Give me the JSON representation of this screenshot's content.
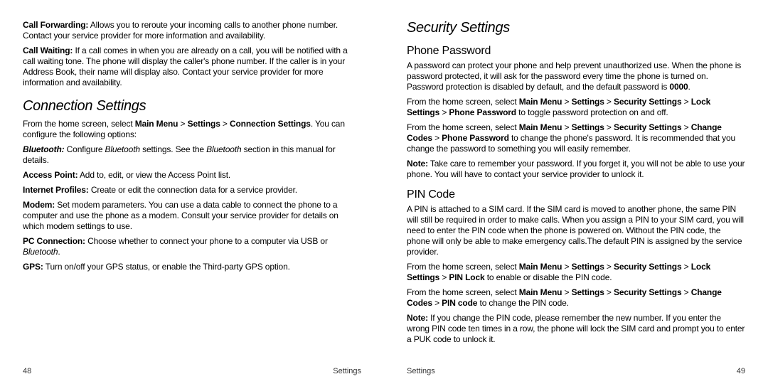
{
  "left": {
    "p1_label": "Call Forwarding:",
    "p1_text": " Allows you to reroute your incoming calls to another phone number. Contact your service provider for more information and availability.",
    "p2_label": "Call Waiting:",
    "p2_text": " If a call comes in when you are already on a call, you will be notified with a call waiting tone. The phone will display the caller's phone number. If the caller is in your Address Book, their name will display also. Contact your service provider for more information and availability.",
    "h2": "Connection Settings",
    "nav_pre": "From the home screen, select ",
    "nav_mm": "Main Menu",
    "gt": " > ",
    "nav_set": "Settings",
    "nav_cs": "Connection Settings",
    "nav_post": ". You can configure the following options:",
    "bt_label": "Bluetooth:",
    "bt_t1": " Configure ",
    "bt_w": "Bluetooth",
    "bt_t2": " settings. See the ",
    "bt_t3": " section in this manual for details.",
    "ap_label": "Access Point:",
    "ap_text": " Add to, edit, or view the Access Point list.",
    "ip_label": "Internet Profiles:",
    "ip_text": " Create or edit the connection data for a service provider.",
    "mo_label": "Modem:",
    "mo_text": " Set modem parameters. You can use a data cable to connect the phone to a computer and use the phone as a modem. Consult your service provider for details on which modem settings to use.",
    "pc_label": "PC Connection:",
    "pc_t1": " Choose whether to connect your phone to a computer via USB or ",
    "pc_t2": ".",
    "gps_label": "GPS:",
    "gps_text": " Turn on/off your GPS status, or enable the Third-party GPS option.",
    "page_no": "48",
    "footer_label": "Settings"
  },
  "right": {
    "h2": "Security Settings",
    "h3a": "Phone Password",
    "pp1_t1": "A password can protect your phone and help prevent unauthorized use. When the phone is password protected, it will ask for the password every time the phone is turned on. Password protection is disabled by default, and the default password is ",
    "pp1_b": "0000",
    "pp1_t2": ".",
    "nav1_pre": "From the home screen, select ",
    "nav_mm": "Main Menu",
    "gt": " > ",
    "nav_set": "Settings",
    "nav_ss": "Security Settings",
    "nav_ls": "Lock Settings",
    "nav_pp": "Phone Password",
    "nav1_post": " to toggle password protection on and off.",
    "nav2_cc": "Change Codes",
    "nav2_post": " to change the phone's password. It is recommended that you change the password to something you will easily remember.",
    "note_label": "Note:",
    "note1_text": " Take care to remember your password. If you forget it, you will not be able to use your phone. You will have to contact your service provider to unlock it.",
    "h3b": "PIN Code",
    "pin1_text": "A PIN is attached to a SIM card. If the SIM card is moved to another phone, the same PIN will still be required in order to make calls. When you assign a PIN to your SIM card, you will need to enter the PIN code when the phone is powered on. Without the PIN code, the phone will only be able to make emergency calls.The default PIN is assigned by the service provider.",
    "nav3_pl": "PIN Lock",
    "nav3_post": " to enable or disable the PIN code.",
    "nav4_pc": "PIN code",
    "nav4_post": " to change the PIN code.",
    "note2_text": " If you change the PIN code, please remember the new number. If you enter the wrong PIN code ten times in a row, the phone will lock the SIM card and prompt you to enter a PUK code to unlock it.",
    "page_no": "49",
    "footer_label": "Settings"
  }
}
